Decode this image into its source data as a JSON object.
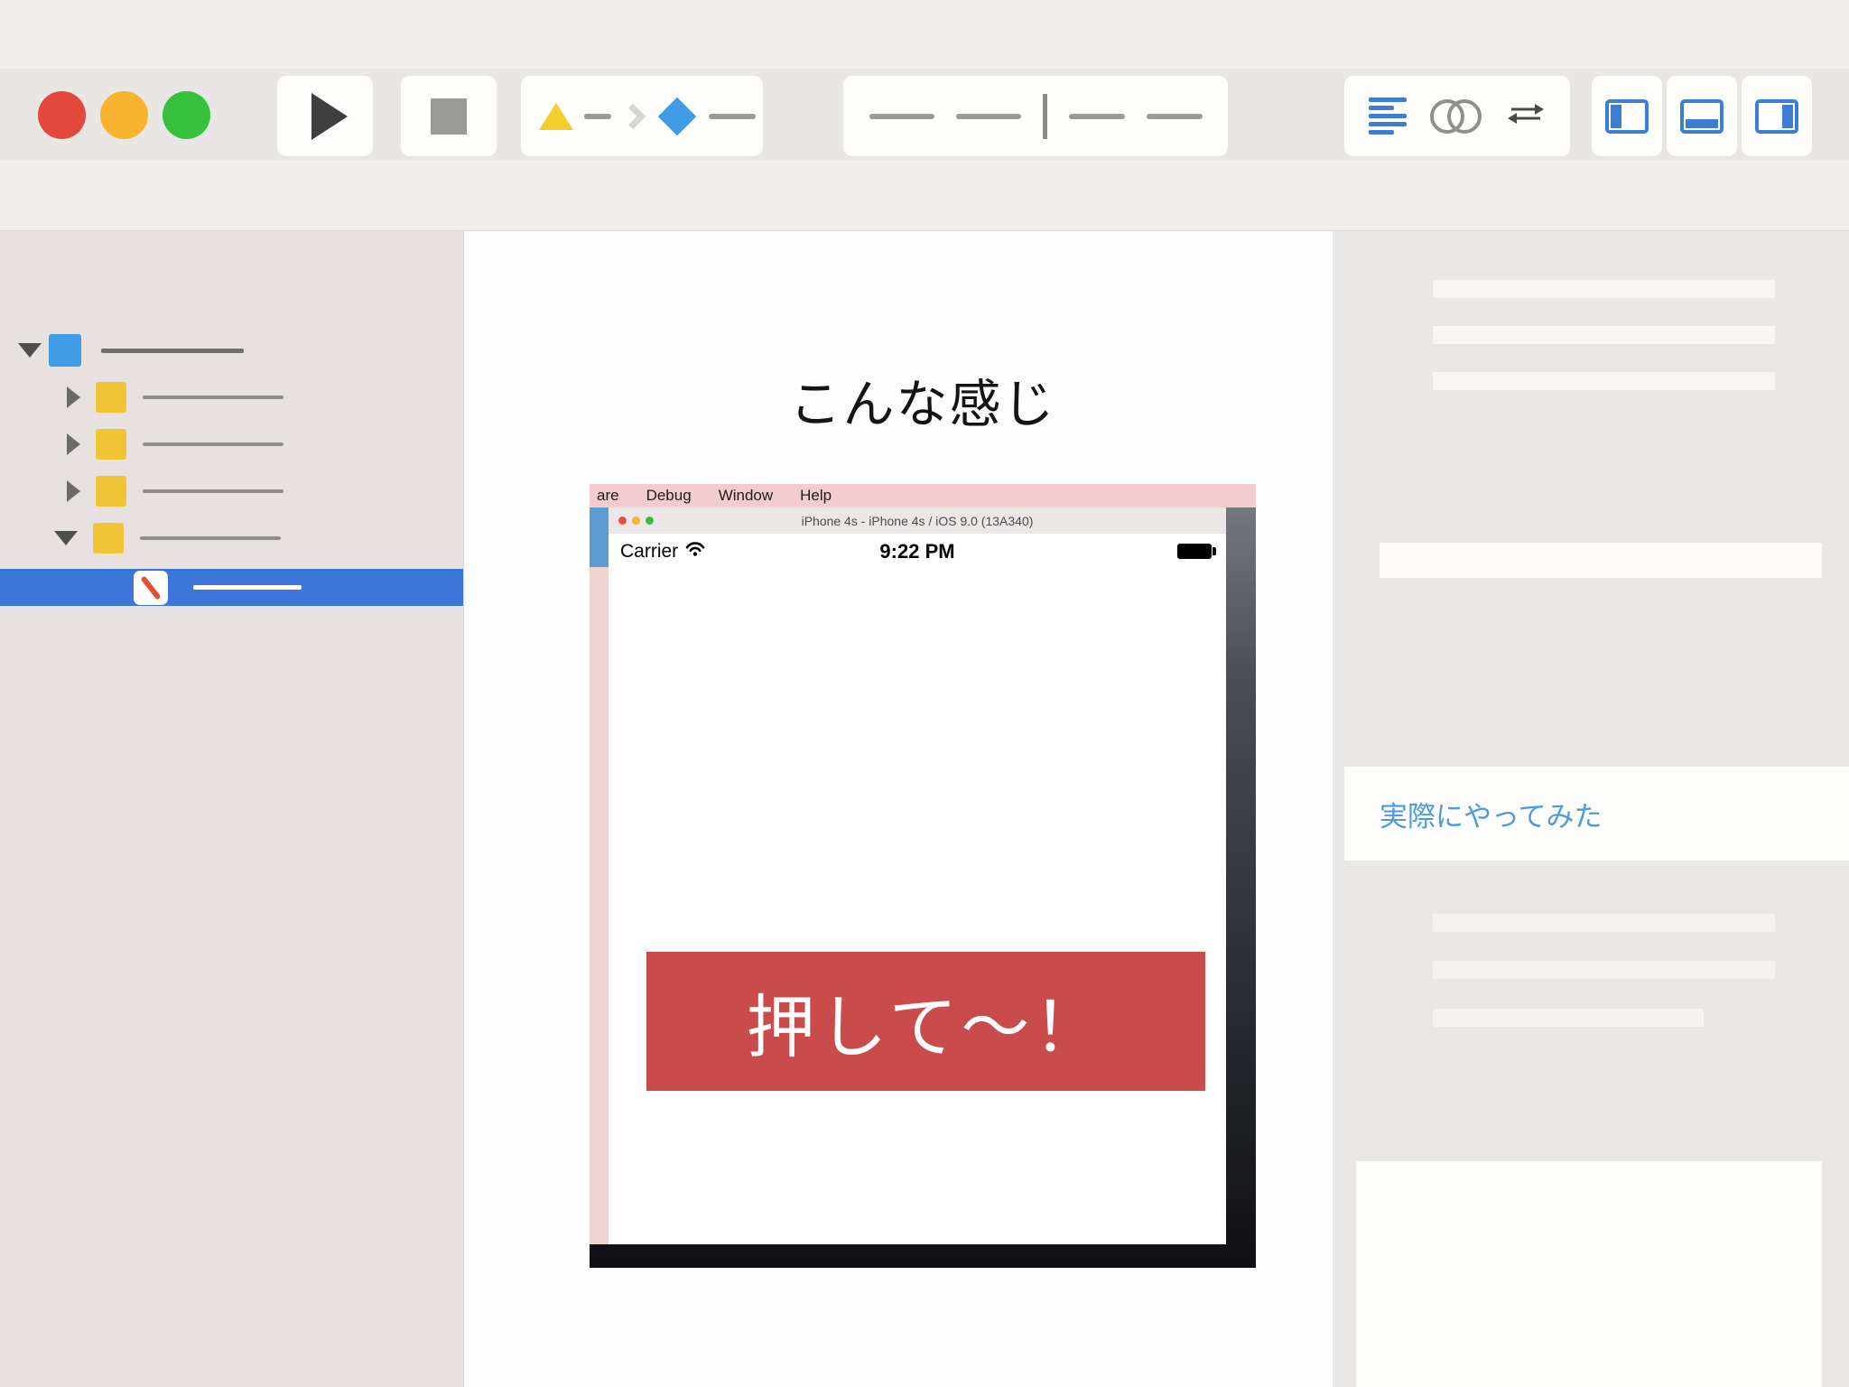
{
  "colors": {
    "accent_blue": "#3b76d8",
    "scheme_blue": "#3f9be3",
    "icon_blue": "#3e7ed2",
    "folder_yellow": "#f0c435",
    "scheme_triangle_yellow": "#f3cf2e",
    "button_red": "#c94b4b",
    "link_blue": "#4e9ad7",
    "traffic_red": "#e3483d",
    "traffic_yellow": "#f7b42c",
    "traffic_green": "#33c13e",
    "selected_row_blue": "#3b76d8",
    "simulator_menubar_pink": "#f3cdce"
  },
  "icons": {
    "toolbar": [
      "play-icon",
      "stop-icon",
      "scheme-triangle-icon",
      "chevron-right-icon",
      "scheme-device-icon",
      "standard-editor-icon",
      "assistant-editor-icon",
      "version-editor-icon",
      "navigator-toggle-icon",
      "debug-area-toggle-icon",
      "inspector-toggle-icon"
    ],
    "navigator": [
      "disclosure-down-icon",
      "disclosure-right-icon",
      "project-icon",
      "folder-icon",
      "file-icon"
    ],
    "simulator": [
      "wifi-icon",
      "battery-icon",
      "traffic-light-dots"
    ]
  },
  "main": {
    "heading": "こんな感じ"
  },
  "simulator": {
    "menu_items": [
      "are",
      "Debug",
      "Window",
      "Help"
    ],
    "window_title": "iPhone 4s - iPhone 4s / iOS 9.0 (13A340)",
    "carrier": "Carrier",
    "time": "9:22 PM",
    "button_label": "押して〜！"
  },
  "inspector": {
    "link_label": "実際にやってみた"
  }
}
